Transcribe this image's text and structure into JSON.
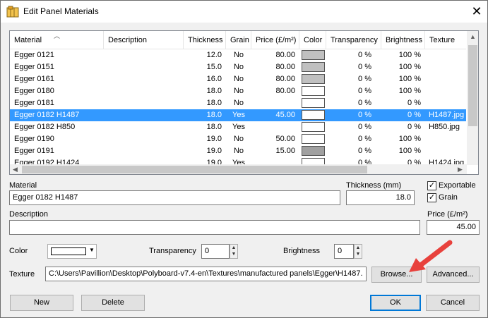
{
  "window": {
    "title": "Edit Panel Materials",
    "close_glyph": "✕"
  },
  "grid": {
    "columns": [
      "Material",
      "Description",
      "Thickness",
      "Grain",
      "Price (£/m²)",
      "Color",
      "Transparency",
      "Brightness",
      "Texture"
    ],
    "rows": [
      {
        "material": "Egger 0121",
        "description": "",
        "thickness": "12.0",
        "grain": "No",
        "price": "80.00",
        "color": "#c0c0c0",
        "transparency": "0 %",
        "brightness": "100 %",
        "texture": ""
      },
      {
        "material": "Egger 0151",
        "description": "",
        "thickness": "15.0",
        "grain": "No",
        "price": "80.00",
        "color": "#c0c0c0",
        "transparency": "0 %",
        "brightness": "100 %",
        "texture": ""
      },
      {
        "material": "Egger 0161",
        "description": "",
        "thickness": "16.0",
        "grain": "No",
        "price": "80.00",
        "color": "#c0c0c0",
        "transparency": "0 %",
        "brightness": "100 %",
        "texture": ""
      },
      {
        "material": "Egger 0180",
        "description": "",
        "thickness": "18.0",
        "grain": "No",
        "price": "80.00",
        "color": "#ffffff",
        "transparency": "0 %",
        "brightness": "100 %",
        "texture": ""
      },
      {
        "material": "Egger 0181",
        "description": "",
        "thickness": "18.0",
        "grain": "No",
        "price": "",
        "color": "#ffffff",
        "transparency": "0 %",
        "brightness": "0 %",
        "texture": ""
      },
      {
        "material": "Egger 0182 H1487",
        "description": "",
        "thickness": "18.0",
        "grain": "Yes",
        "price": "45.00",
        "color": "#ffffff",
        "transparency": "0 %",
        "brightness": "0 %",
        "texture": "H1487.jpg",
        "selected": true
      },
      {
        "material": "Egger 0182 H850",
        "description": "",
        "thickness": "18.0",
        "grain": "Yes",
        "price": "",
        "color": "#ffffff",
        "transparency": "0 %",
        "brightness": "0 %",
        "texture": "H850.jpg"
      },
      {
        "material": "Egger 0190",
        "description": "",
        "thickness": "19.0",
        "grain": "No",
        "price": "50.00",
        "color": "#ffffff",
        "transparency": "0 %",
        "brightness": "100 %",
        "texture": ""
      },
      {
        "material": "Egger 0191",
        "description": "",
        "thickness": "19.0",
        "grain": "No",
        "price": "15.00",
        "color": "#a0a0a0",
        "transparency": "0 %",
        "brightness": "100 %",
        "texture": ""
      },
      {
        "material": "Egger 0192 H1424",
        "description": "",
        "thickness": "19.0",
        "grain": "Yes",
        "price": "",
        "color": "#ffffff",
        "transparency": "0 %",
        "brightness": "0 %",
        "texture": "H1424.jpg"
      }
    ]
  },
  "form": {
    "material_label": "Material",
    "material_value": "Egger 0182 H1487",
    "thickness_label": "Thickness (mm)",
    "thickness_value": "18.0",
    "exportable_label": "Exportable",
    "grain_label": "Grain",
    "description_label": "Description",
    "description_value": "",
    "price_label": "Price (£/m²)",
    "price_value": "45.00",
    "color_label": "Color",
    "color_value": "#ffffff",
    "transparency_label": "Transparency",
    "transparency_value": "0",
    "brightness_label": "Brightness",
    "brightness_value": "0",
    "texture_label": "Texture",
    "texture_value": "C:\\Users\\Pavillion\\Desktop\\Polyboard-v7.4-en\\Textures\\manufactured panels\\Egger\\H1487.",
    "browse_label": "Browse...",
    "advanced_label": "Advanced..."
  },
  "buttons": {
    "new": "New",
    "delete": "Delete",
    "ok": "OK",
    "cancel": "Cancel"
  },
  "annotation": {
    "arrow_color": "#e8413c"
  }
}
